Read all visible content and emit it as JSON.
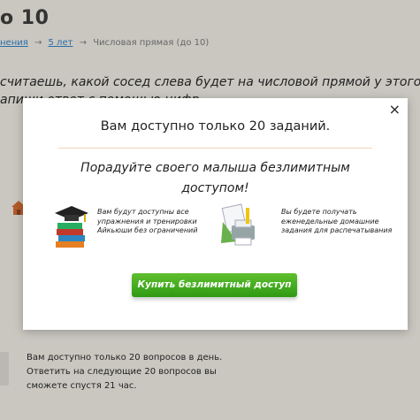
{
  "background": {
    "title": "о 10",
    "breadcrumb": [
      {
        "label": "нения"
      },
      {
        "label": "5 лет"
      },
      {
        "label": "Числовая прямая (до 10)"
      }
    ],
    "question_line1": "считаешь, какой сосед слева будет на числовой прямой у этого",
    "question_line2": "апиши ответ с помощью цифр.",
    "bottom_msg": "Вам доступно только 20 вопросов в день. Ответить на следующие 20 вопросов вы сможете спустя 21 час."
  },
  "modal": {
    "close_label": "×",
    "title": "Вам доступно только 20 заданий.",
    "subtitle": "Порадуйте своего малыша безлимитным доступом!",
    "features": [
      {
        "icon": "graduation-books-icon",
        "text": "Вам будут доступны все упражнения и тренировки Айкьюши без ограничений"
      },
      {
        "icon": "printer-papers-icon",
        "text": "Вы будете получать еженедельные домашние задания для распечатывания"
      }
    ],
    "buy_button_label": "Купить безлимитный доступ"
  },
  "colors": {
    "overlay": "#c9c7c0",
    "button_green": "#3da81c",
    "link": "#2b6fa8"
  }
}
